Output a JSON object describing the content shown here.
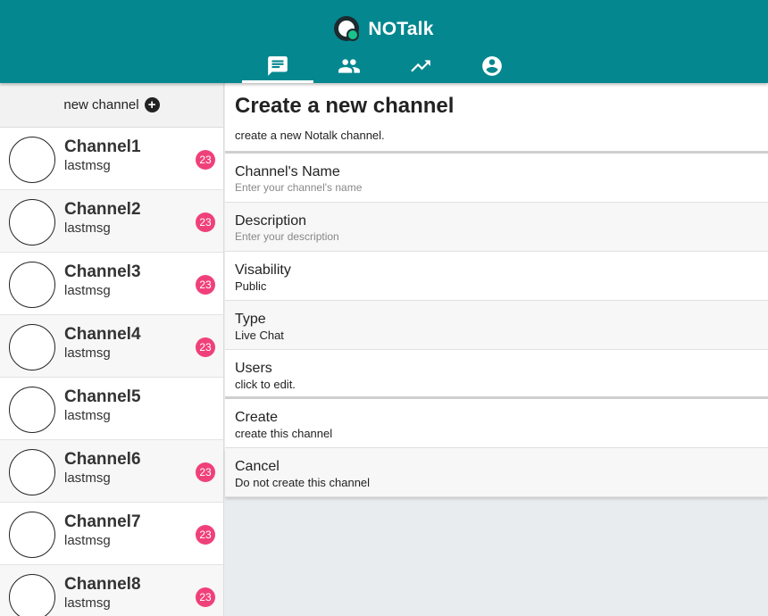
{
  "app": {
    "name": "NOTalk"
  },
  "nav": {
    "tabs": [
      {
        "icon": "chat-icon",
        "active": true
      },
      {
        "icon": "people-icon",
        "active": false
      },
      {
        "icon": "trending-up-icon",
        "active": false
      },
      {
        "icon": "account-circle-icon",
        "active": false
      }
    ]
  },
  "sidebar": {
    "new_channel_label": "new channel",
    "channels": [
      {
        "name": "Channel1",
        "last_msg": "lastmsg",
        "unread": "23"
      },
      {
        "name": "Channel2",
        "last_msg": "lastmsg",
        "unread": "23"
      },
      {
        "name": "Channel3",
        "last_msg": "lastmsg",
        "unread": "23"
      },
      {
        "name": "Channel4",
        "last_msg": "lastmsg",
        "unread": "23"
      },
      {
        "name": "Channel5",
        "last_msg": "lastmsg",
        "unread": ""
      },
      {
        "name": "Channel6",
        "last_msg": "lastmsg",
        "unread": "23"
      },
      {
        "name": "Channel7",
        "last_msg": "lastmsg",
        "unread": "23"
      },
      {
        "name": "Channel8",
        "last_msg": "lastmsg",
        "unread": "23"
      }
    ]
  },
  "form": {
    "title": "Create a new channel",
    "subtitle": "create a new Notalk channel.",
    "name_label": "Channel's Name",
    "name_placeholder": "Enter your channel's name",
    "description_label": "Description",
    "description_placeholder": "Enter your description",
    "visibility_label": "Visability",
    "visibility_value": "Public",
    "type_label": "Type",
    "type_value": "Live Chat",
    "users_label": "Users",
    "users_value": "click to edit.",
    "create_label": "Create",
    "create_desc": "create this channel",
    "cancel_label": "Cancel",
    "cancel_desc": "Do not create this channel"
  },
  "colors": {
    "header": "#04878f",
    "badge": "#f0407a",
    "logo_dot": "#18c48c"
  }
}
